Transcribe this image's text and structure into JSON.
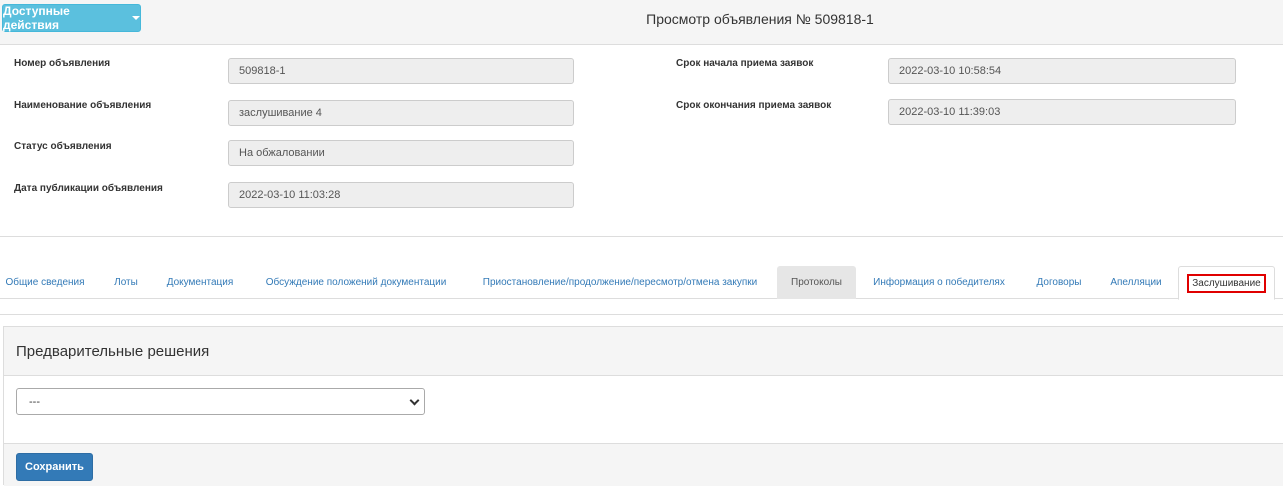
{
  "header": {
    "actions_label": "Доступные действия",
    "title": "Просмотр объявления № 509818-1"
  },
  "fields": {
    "number_label": "Номер объявления",
    "number_value": "509818-1",
    "name_label": "Наименование объявления",
    "name_value": "заслушивание 4",
    "status_label": "Статус объявления",
    "status_value": "На обжаловании",
    "pubdate_label": "Дата публикации объявления",
    "pubdate_value": "2022-03-10 11:03:28",
    "start_label": "Срок начала приема заявок",
    "start_value": "2022-03-10 10:58:54",
    "end_label": "Срок окончания приема заявок",
    "end_value": "2022-03-10 11:39:03"
  },
  "tabs": [
    "Общие сведения",
    "Лоты",
    "Документация",
    "Обсуждение положений документации",
    "Приостановление/продолжение/пересмотр/отмена закупки",
    "Протоколы",
    "Информация о победителях",
    "Договоры",
    "Апелляции",
    "Заслушивание"
  ],
  "panel": {
    "title": "Предварительные решения",
    "select_value": "---",
    "save_label": "Сохранить"
  }
}
